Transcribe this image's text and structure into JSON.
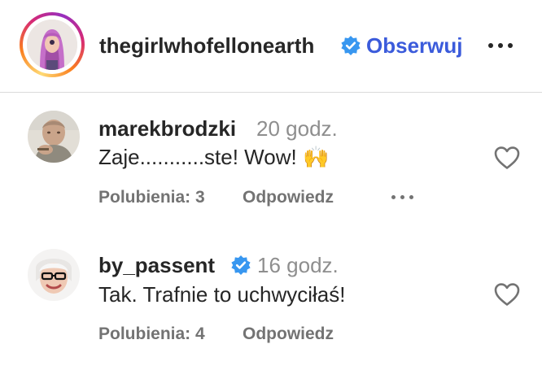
{
  "post_owner": {
    "username": "thegirlwhofellonearth",
    "follow_label": "Obserwuj",
    "verified_icon": "verified-badge-icon",
    "more_icon": "more-options-icon"
  },
  "comments": [
    {
      "username": "marekbrodzki",
      "time": "20 godz.",
      "text": "Zaje...........ste! Wow!",
      "emoji": "🙌",
      "likes_label": "Polubienia: 3",
      "reply_label": "Odpowiedz",
      "verified": false
    },
    {
      "username": "by_passent",
      "time": "16 godz.",
      "text": "Tak. Trafnie to uchwyciłaś!",
      "likes_label": "Polubienia: 4",
      "reply_label": "Odpowiedz",
      "verified": true
    }
  ],
  "colors": {
    "verified_blue": "#3897f0",
    "follow_blue": "#3b5bdb",
    "muted_gray": "#8e8e8e",
    "meta_gray": "#737373"
  }
}
